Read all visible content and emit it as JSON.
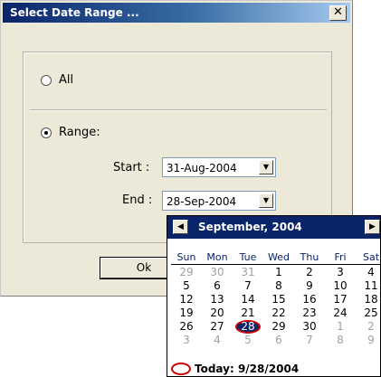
{
  "dialog": {
    "title": "Select Date Range ...",
    "close_glyph": "✕",
    "option_all": "All",
    "option_range": "Range:",
    "start_label": "Start :",
    "start_value": "31-Aug-2004",
    "end_label": "End :",
    "end_value": "28-Sep-2004",
    "ok_label": "Ok",
    "selected_option": "range"
  },
  "calendar": {
    "month_label": "September, 2004",
    "prev_glyph": "◀",
    "next_glyph": "▶",
    "weekdays": [
      "Sun",
      "Mon",
      "Tue",
      "Wed",
      "Thu",
      "Fri",
      "Sat"
    ],
    "weeks": [
      [
        "29",
        "30",
        "31",
        "1",
        "2",
        "3",
        "4"
      ],
      [
        "5",
        "6",
        "7",
        "8",
        "9",
        "10",
        "11"
      ],
      [
        "12",
        "13",
        "14",
        "15",
        "16",
        "17",
        "18"
      ],
      [
        "19",
        "20",
        "21",
        "22",
        "23",
        "24",
        "25"
      ],
      [
        "26",
        "27",
        "28",
        "29",
        "30",
        "1",
        "2"
      ],
      [
        "3",
        "4",
        "5",
        "6",
        "7",
        "8",
        "9"
      ]
    ],
    "selected_day": "28",
    "today_label": "Today: 9/28/2004"
  },
  "colors": {
    "title_bar": "#0a246a",
    "calendar_header": "#0a246a",
    "selection_ring": "#cc0000"
  }
}
